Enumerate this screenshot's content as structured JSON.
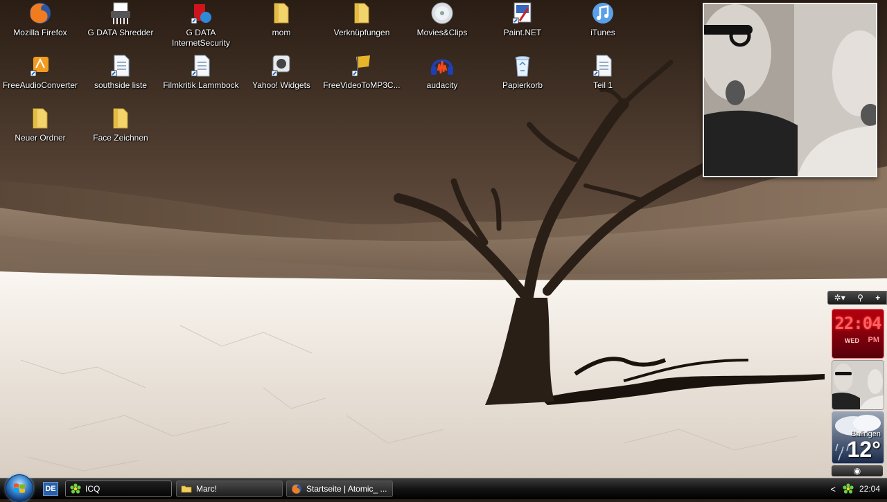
{
  "desktop": {
    "icons": [
      {
        "label": "Mozilla Firefox",
        "icon": "firefox-icon"
      },
      {
        "label": "G DATA Shredder",
        "icon": "shredder-icon"
      },
      {
        "label": "G DATA\nInternetSecurity",
        "icon": "gdata-icon"
      },
      {
        "label": "mom",
        "icon": "folder-icon"
      },
      {
        "label": "Verknüpfungen",
        "icon": "folder-icon"
      },
      {
        "label": "Movies&Clips",
        "icon": "cd-icon"
      },
      {
        "label": "Paint.NET",
        "icon": "paintnet-icon"
      },
      {
        "label": "iTunes",
        "icon": "itunes-icon"
      },
      {
        "label": "FreeAudioConverter",
        "icon": "audio-converter-icon"
      },
      {
        "label": "southside liste",
        "icon": "document-icon"
      },
      {
        "label": "Filmkritik Lammbock",
        "icon": "document-icon"
      },
      {
        "label": "Yahoo! Widgets",
        "icon": "yahoo-widgets-icon"
      },
      {
        "label": "FreeVideoToMP3C...",
        "icon": "video-converter-icon"
      },
      {
        "label": "audacity",
        "icon": "audacity-icon"
      },
      {
        "label": "Papierkorb",
        "icon": "recycle-bin-icon"
      },
      {
        "label": "Teil 1",
        "icon": "document-icon"
      },
      {
        "label": "Neuer Ordner",
        "icon": "folder-icon"
      },
      {
        "label": "Face Zeichnen",
        "icon": "folder-icon"
      }
    ]
  },
  "sidebar": {
    "toolbar": {
      "settings": "✲▾",
      "search": "⚲",
      "add": "+"
    },
    "clock": {
      "time": "22:04",
      "day": "WED",
      "ampm": "PM"
    },
    "weather": {
      "city": "Balingen",
      "temp": "12°"
    },
    "footer_icon": "sidebar-toggle-icon"
  },
  "taskbar": {
    "language": "DE",
    "tasks": [
      {
        "label": "ICQ",
        "icon": "icq-icon",
        "active": true
      },
      {
        "label": "Marc!",
        "icon": "folder-icon",
        "active": false
      },
      {
        "label": "Startseite | Atomic_ ...",
        "icon": "firefox-icon",
        "active": false
      }
    ],
    "tray": {
      "chevron": "<",
      "time": "22:04"
    }
  },
  "colors": {
    "accent_clock": "#ff3030",
    "taskbar": "#141414",
    "sepia_sky": "#3a2b1f",
    "sepia_sand": "#a08a74",
    "saltpan": "#f3ede6"
  }
}
